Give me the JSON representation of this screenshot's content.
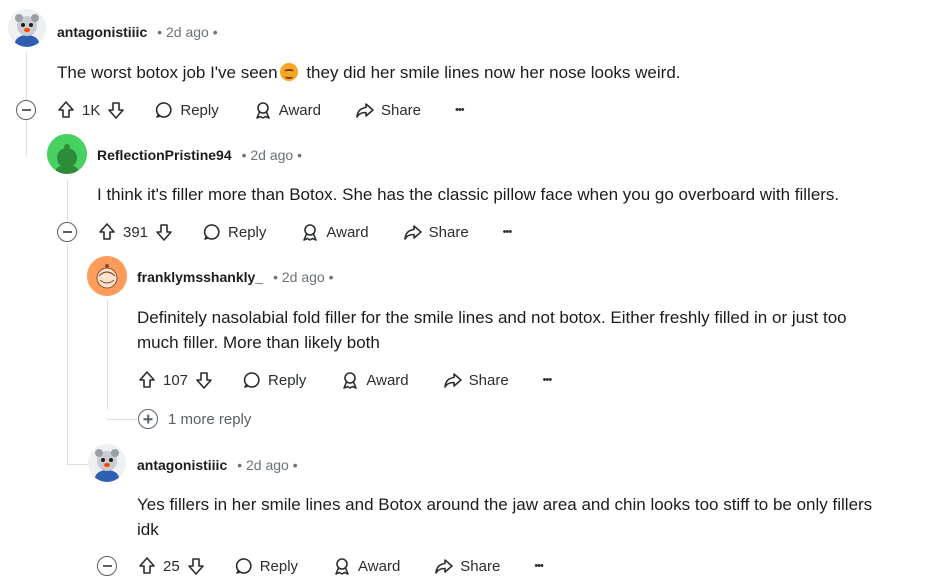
{
  "actions": {
    "reply": "Reply",
    "award": "Award",
    "share": "Share",
    "more": "•••"
  },
  "comments": [
    {
      "username": "antagonistiiic",
      "time": "• 2d ago •",
      "body_before_emoji": "The worst botox job I've seen",
      "emoji": "face-with-cold-sweat-emoji",
      "body_after_emoji": " they did her smile lines now her nose looks weird.",
      "votes": "1K"
    },
    {
      "username": "ReflectionPristine94",
      "time": "• 2d ago •",
      "body": "I think it's filler more than Botox. She has the classic pillow face when you go overboard with fillers.",
      "votes": "391"
    },
    {
      "username": "franklymsshankly_",
      "time": "• 2d ago •",
      "body_line1": "Definitely nasolabial fold filler for the smile lines and not botox. Either freshly filled in or just too",
      "body_line2": "much filler. More than likely both",
      "votes": "107",
      "more_replies": "1 more reply"
    },
    {
      "username": "antagonistiiic",
      "time": "• 2d ago •",
      "body_line1": "Yes fillers in her smile lines and Botox around the jaw area and chin looks too stiff to be only fillers",
      "body_line2": "idk",
      "votes": "25"
    }
  ],
  "colors": {
    "avatar_green": "#46d160",
    "avatar_orange": "#ff9c5b",
    "thread_line": "#dcdfe2",
    "meta_gray": "#6b7378"
  }
}
